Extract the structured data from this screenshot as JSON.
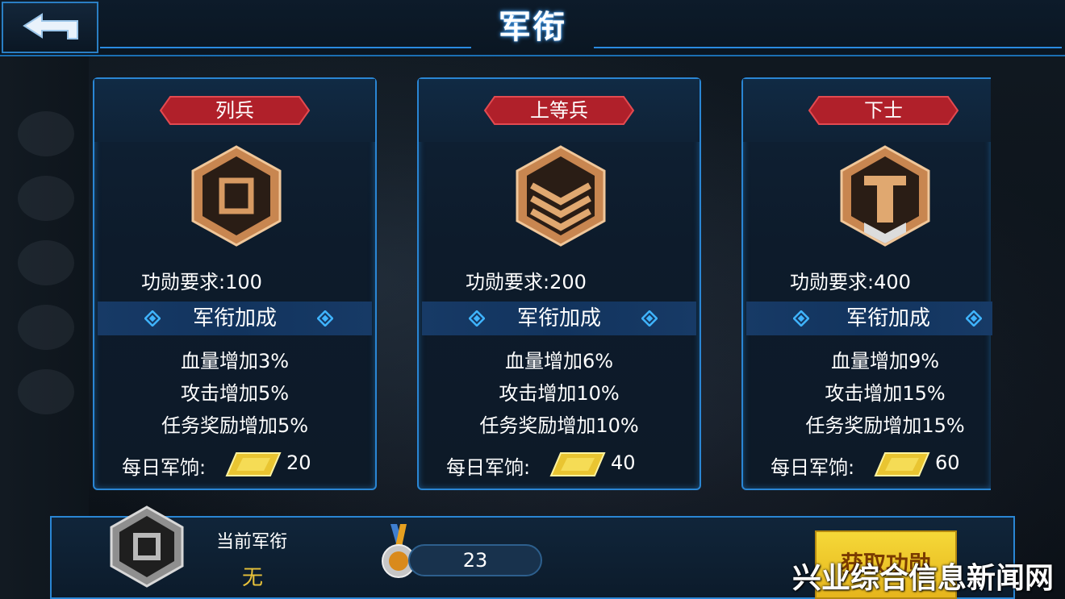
{
  "header": {
    "title": "军衔"
  },
  "ranks": [
    {
      "name": "列兵",
      "requirement": "功勋要求:100",
      "bonus_title": "军衔加成",
      "stats": [
        "血量增加3%",
        "攻击增加5%",
        "任务奖励增加5%"
      ],
      "salary_label": "每日军饷:",
      "salary_value": "20",
      "emblem": "private-emblem-icon"
    },
    {
      "name": "上等兵",
      "requirement": "功勋要求:200",
      "bonus_title": "军衔加成",
      "stats": [
        "血量增加6%",
        "攻击增加10%",
        "任务奖励增加10%"
      ],
      "salary_label": "每日军饷:",
      "salary_value": "40",
      "emblem": "private-first-class-emblem-icon"
    },
    {
      "name": "下士",
      "requirement": "功勋要求:400",
      "bonus_title": "军衔加成",
      "stats": [
        "血量增加9%",
        "攻击增加15%",
        "任务奖励增加15%"
      ],
      "salary_label": "每日军饷:",
      "salary_value": "60",
      "emblem": "corporal-emblem-icon"
    }
  ],
  "current": {
    "label": "当前军衔",
    "value": "无",
    "merit_value": "23",
    "get_merit_button": "获取功勋"
  },
  "watermark": "兴业综合信息新闻网",
  "colors": {
    "accent": "#2a86d4",
    "banner_red": "#b0202a",
    "gold": "#e8c23a",
    "button_yellow": "#f5d838"
  }
}
